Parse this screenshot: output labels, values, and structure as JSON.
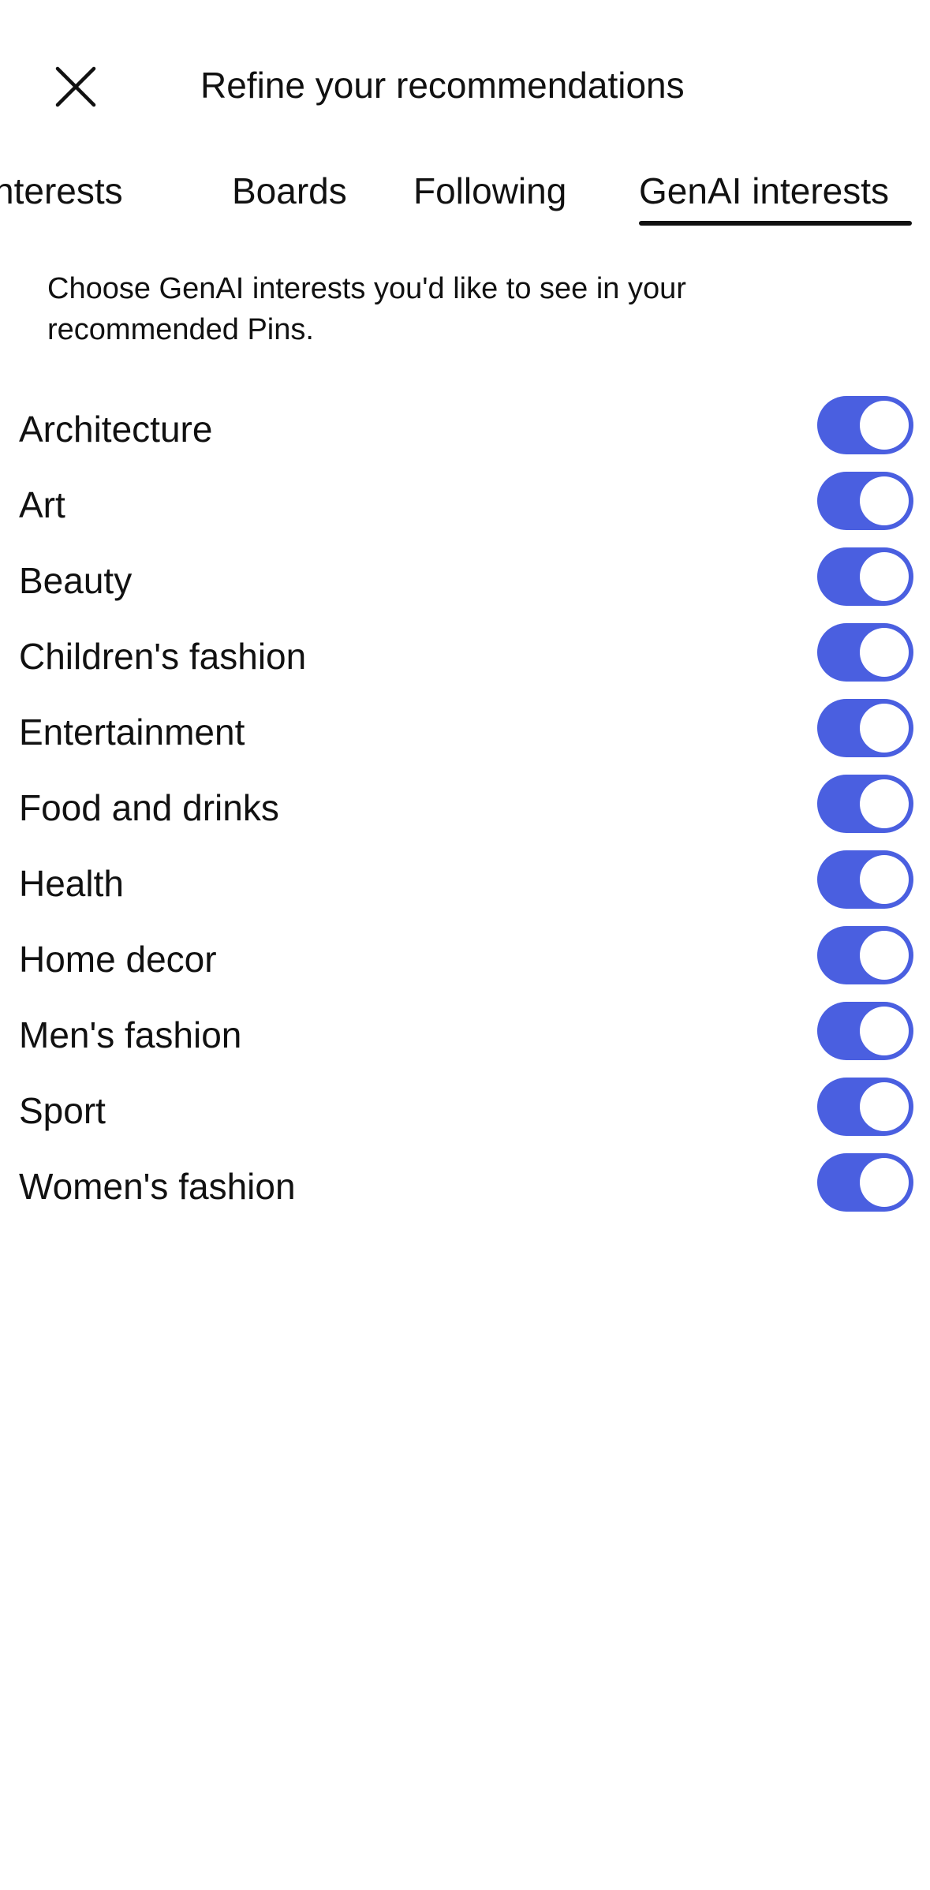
{
  "header": {
    "title": "Refine your recommendations",
    "close_icon": "close-icon"
  },
  "tabs": [
    {
      "label": "nterests",
      "active": false
    },
    {
      "label": "Boards",
      "active": false
    },
    {
      "label": "Following",
      "active": false
    },
    {
      "label": "GenAI interests",
      "active": true
    }
  ],
  "description": "Choose GenAI interests you'd like to see in your recommended Pins.",
  "accent_color": "#4a5fe0",
  "interests": [
    {
      "label": "Architecture",
      "enabled": true
    },
    {
      "label": "Art",
      "enabled": true
    },
    {
      "label": "Beauty",
      "enabled": true
    },
    {
      "label": "Children's fashion",
      "enabled": true
    },
    {
      "label": "Entertainment",
      "enabled": true
    },
    {
      "label": "Food and drinks",
      "enabled": true
    },
    {
      "label": "Health",
      "enabled": true
    },
    {
      "label": "Home decor",
      "enabled": true
    },
    {
      "label": "Men's fashion",
      "enabled": true
    },
    {
      "label": "Sport",
      "enabled": true
    },
    {
      "label": "Women's fashion",
      "enabled": true
    }
  ]
}
